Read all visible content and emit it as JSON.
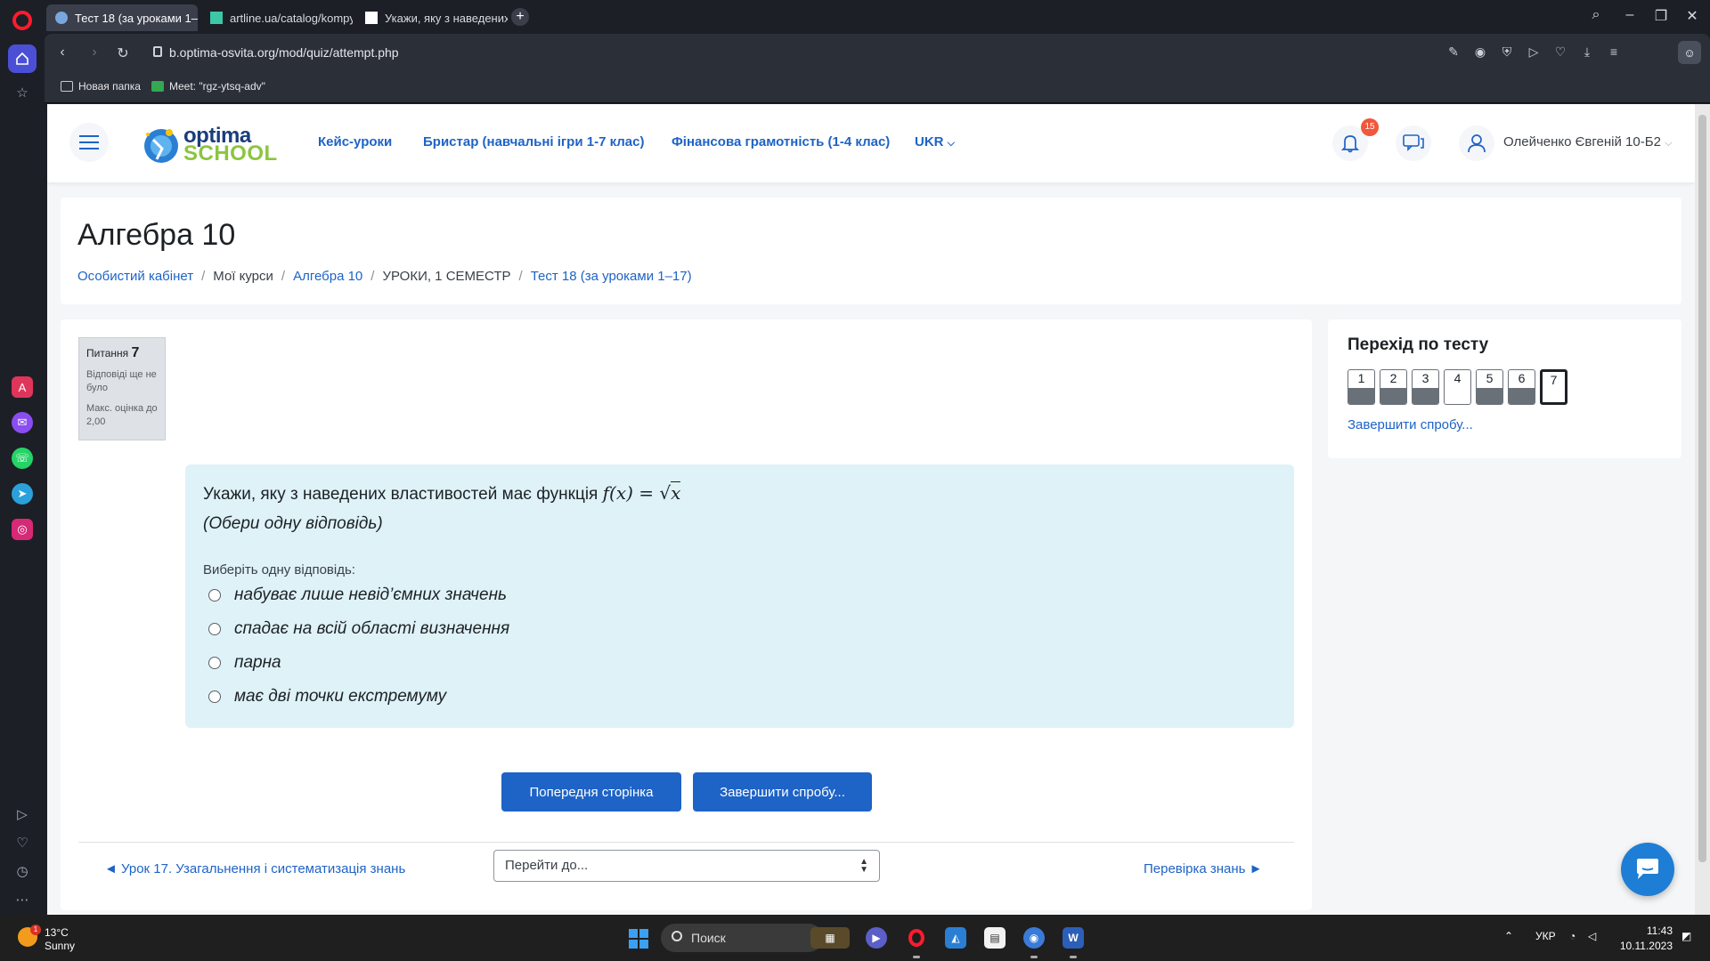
{
  "browser": {
    "tabs": [
      {
        "label": "Тест 18 (за уроками 1–17)"
      },
      {
        "label": "artline.ua/catalog/kompyu"
      },
      {
        "label": "Укажи, яку з наведених в"
      }
    ],
    "url": "b.optima-osvita.org/mod/quiz/attempt.php",
    "bookmarks": [
      {
        "label": "Новая папка"
      },
      {
        "label": "Meet: \"rgz-ytsq-adv\""
      }
    ]
  },
  "header": {
    "logo": {
      "line1": "optima",
      "line2": "SCHOOL"
    },
    "nav": [
      {
        "label": "Кейс-уроки"
      },
      {
        "label": "Бристар (навчальні ігри 1-7 клас)"
      },
      {
        "label": "Фінансова грамотність (1-4 клас)"
      },
      {
        "label": "UKR"
      }
    ],
    "notifications_count": "15",
    "user_name": "Олейченко Євгеній 10-Б2"
  },
  "page": {
    "title": "Алгебра 10",
    "breadcrumb": [
      {
        "label": "Особистий кабінет",
        "link": true
      },
      {
        "label": "Мої курси",
        "link": false
      },
      {
        "label": "Алгебра 10",
        "link": true
      },
      {
        "label": "УРОКИ, 1 СЕМЕСТР",
        "link": false
      },
      {
        "label": "Тест 18 (за уроками 1–17)",
        "link": true
      }
    ]
  },
  "question": {
    "info_label": "Питання",
    "number": "7",
    "status": "Відповіді ще не було",
    "max_grade": "Макс. оцінка до 2,00",
    "text": "Укажи, яку з наведених властивостей має функція",
    "formula_lhs": "f(x) =",
    "formula_rhs": "x",
    "subtext": "(Обери одну відповідь)",
    "choose_label": "Виберіть одну відповідь:",
    "answers": [
      {
        "label": "набуває лише невід’ємних значень"
      },
      {
        "label": "спадає на всій області визначення"
      },
      {
        "label": "парна"
      },
      {
        "label": "має дві точки екстремуму"
      }
    ]
  },
  "buttons": {
    "prev_page": "Попередня сторінка",
    "finish_attempt": "Завершити спробу..."
  },
  "footer_nav": {
    "prev": "◄ Урок 17. Узагальнення і систематизація знань",
    "jump_placeholder": "Перейти до...",
    "next": "Перевірка знань ►"
  },
  "quiz_nav": {
    "title": "Перехід по тесту",
    "questions": [
      {
        "num": "1",
        "answered": true
      },
      {
        "num": "2",
        "answered": true
      },
      {
        "num": "3",
        "answered": true
      },
      {
        "num": "4",
        "answered": false
      },
      {
        "num": "5",
        "answered": true
      },
      {
        "num": "6",
        "answered": true
      },
      {
        "num": "7",
        "answered": false,
        "current": true
      }
    ],
    "finish_link": "Завершити спробу..."
  },
  "taskbar": {
    "weather_temp": "13°C",
    "weather_desc": "Sunny",
    "weather_badge": "1",
    "search_label": "Поиск",
    "lang": "УКР",
    "time": "11:43",
    "date": "10.11.2023"
  }
}
